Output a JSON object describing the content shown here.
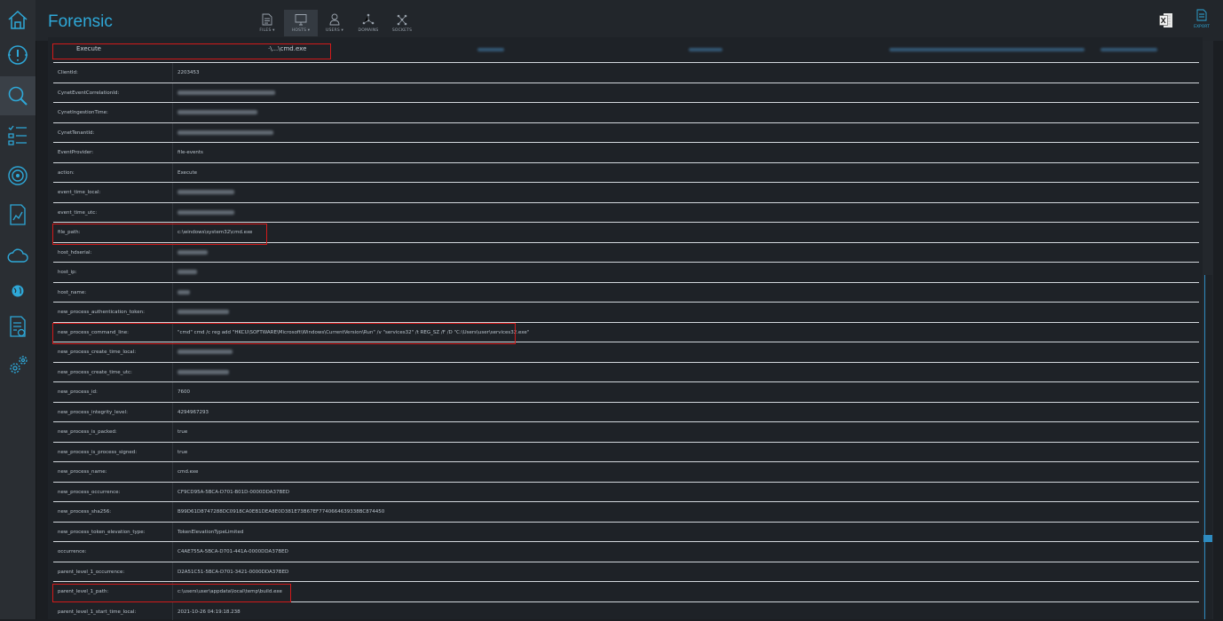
{
  "app": {
    "title": "Forensic"
  },
  "nav": [
    {
      "label": "FILES ▾",
      "icon": "file-icon"
    },
    {
      "label": "HOSTS ▾",
      "icon": "monitor-icon"
    },
    {
      "label": "USERS ▾",
      "icon": "user-icon"
    },
    {
      "label": "DOMAINS",
      "icon": "network-icon"
    },
    {
      "label": "SOCKETS",
      "icon": "socket-icon"
    }
  ],
  "toolbar": {
    "export_label": "EXPORT"
  },
  "header_row": {
    "action": "Execute",
    "path": "·\\...\\cmd.exe"
  },
  "rows": [
    {
      "key": "ClientId:",
      "value": "2203453"
    },
    {
      "key": "CynetEventCorrelationId:",
      "value": ""
    },
    {
      "key": "CynetIngestionTime:",
      "value": ""
    },
    {
      "key": "CynetTenantId:",
      "value": ""
    },
    {
      "key": "EventProvider:",
      "value": "file-events"
    },
    {
      "key": "action:",
      "value": "Execute"
    },
    {
      "key": "event_time_local:",
      "value": ""
    },
    {
      "key": "event_time_utc:",
      "value": ""
    },
    {
      "key": "file_path:",
      "value": "c:\\windows\\system32\\cmd.exe"
    },
    {
      "key": "host_hdserial:",
      "value": ""
    },
    {
      "key": "host_ip:",
      "value": ""
    },
    {
      "key": "host_name:",
      "value": ""
    },
    {
      "key": "new_process_authentication_token:",
      "value": ""
    },
    {
      "key": "new_process_command_line:",
      "value": "\"cmd\" cmd /c reg add \"HKCU\\SOFTWARE\\Microsoft\\Windows\\CurrentVersion\\Run\" /v \"services32\" /t REG_SZ /F /D \"C:\\Users\\user\\services32.exe\""
    },
    {
      "key": "new_process_create_time_local:",
      "value": ""
    },
    {
      "key": "new_process_create_time_utc:",
      "value": ""
    },
    {
      "key": "new_process_id:",
      "value": "7600"
    },
    {
      "key": "new_process_integrity_level:",
      "value": "4294967293"
    },
    {
      "key": "new_process_is_packed:",
      "value": "true"
    },
    {
      "key": "new_process_is_process_signed:",
      "value": "true"
    },
    {
      "key": "new_process_name:",
      "value": "cmd.exe"
    },
    {
      "key": "new_process_occurrence:",
      "value": "CF9CD95A-5BCA-D701-B01D-0000DDA37BED"
    },
    {
      "key": "new_process_sha256:",
      "value": "B99D61D8747288DC0918CA0EB1DEA8E0D381E73B67EF7740664639338BC874450"
    },
    {
      "key": "new_process_token_elevation_type:",
      "value": "TokenElevationTypeLimited"
    },
    {
      "key": "occurrence:",
      "value": "C4AE755A-5BCA-D701-441A-0000DDA37BED"
    },
    {
      "key": "parent_level_1_occurrence:",
      "value": "D2A51C51-5BCA-D701-3421-0000DDA37BED"
    },
    {
      "key": "parent_level_1_path:",
      "value": "c:\\users\\user\\appdata\\local\\temp\\build.exe"
    },
    {
      "key": "parent_level_1_start_time_local:",
      "value": "2021-10-26 04:19:18.238"
    }
  ],
  "colors": {
    "accent": "#2ea8d8",
    "highlight": "#d21a1a",
    "background": "#1e2227"
  }
}
